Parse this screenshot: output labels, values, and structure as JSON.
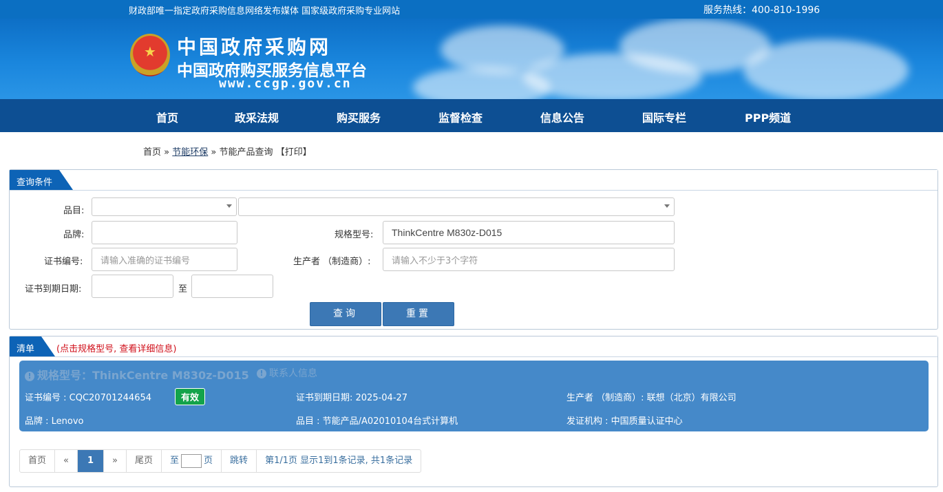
{
  "topbar": {
    "left_text": "财政部唯一指定政府采购信息网络发布媒体 国家级政府采购专业网站",
    "hotline": "服务热线：400-810-1996"
  },
  "banner": {
    "title_line1": "中国政府采购网",
    "title_line2": "中国政府购买服务信息平台",
    "url": "www.ccgp.gov.cn"
  },
  "nav": {
    "items": [
      "首页",
      "政采法规",
      "购买服务",
      "监督检查",
      "信息公告",
      "国际专栏",
      "PPP频道"
    ]
  },
  "breadcrumb": {
    "home": "首页",
    "sep1": "»",
    "section": "节能环保",
    "sep2": "»",
    "page": "节能产品查询",
    "print": "【打印】"
  },
  "query": {
    "tab_label": "查询条件",
    "category_label": "品目:",
    "category_value1": "",
    "category_value2": "",
    "brand_label": "品牌:",
    "brand_value": "",
    "model_label": "规格型号:",
    "model_value": "ThinkCentre M830z-D015",
    "cert_no_label": "证书编号:",
    "cert_no_placeholder": "请输入准确的证书编号",
    "maker_label": "生产者 （制造商）:",
    "maker_placeholder": "请输入不少于3个字符",
    "expiry_label": "证书到期日期:",
    "expiry_from": "",
    "expiry_to_sep": "至",
    "expiry_to": "",
    "search_button": "查询",
    "reset_button": "重置"
  },
  "results": {
    "tab_label": "清单",
    "hint": "(点击规格型号, 查看详细信息)",
    "items": [
      {
        "title": "规格型号：ThinkCentre M830z-D015",
        "contact": "联系人信息",
        "cert_no": "证书编号 : CQC20701244654",
        "status": "有效",
        "expiry": "证书到期日期: 2025-04-27",
        "maker": "生产者 （制造商）: 联想（北京）有限公司",
        "brand": "品牌 : Lenovo",
        "category": "品目 : 节能产品/A02010104台式计算机",
        "issuer": "发证机构 : 中国质量认证中心"
      }
    ]
  },
  "pager": {
    "first": "首页",
    "prev": "«",
    "current": "1",
    "next": "»",
    "last": "尾页",
    "goto_prefix": "至",
    "goto_suffix": "页",
    "jump": "跳转",
    "summary": "第1/1页  显示1到1条记录, 共1条记录"
  },
  "colors": {
    "topbar": "#0b6fc2",
    "nav": "#0d4f93",
    "card": "#4589c9",
    "button": "#3c78b5",
    "status_valid": "#13a34a",
    "hint": "#d0101b"
  }
}
